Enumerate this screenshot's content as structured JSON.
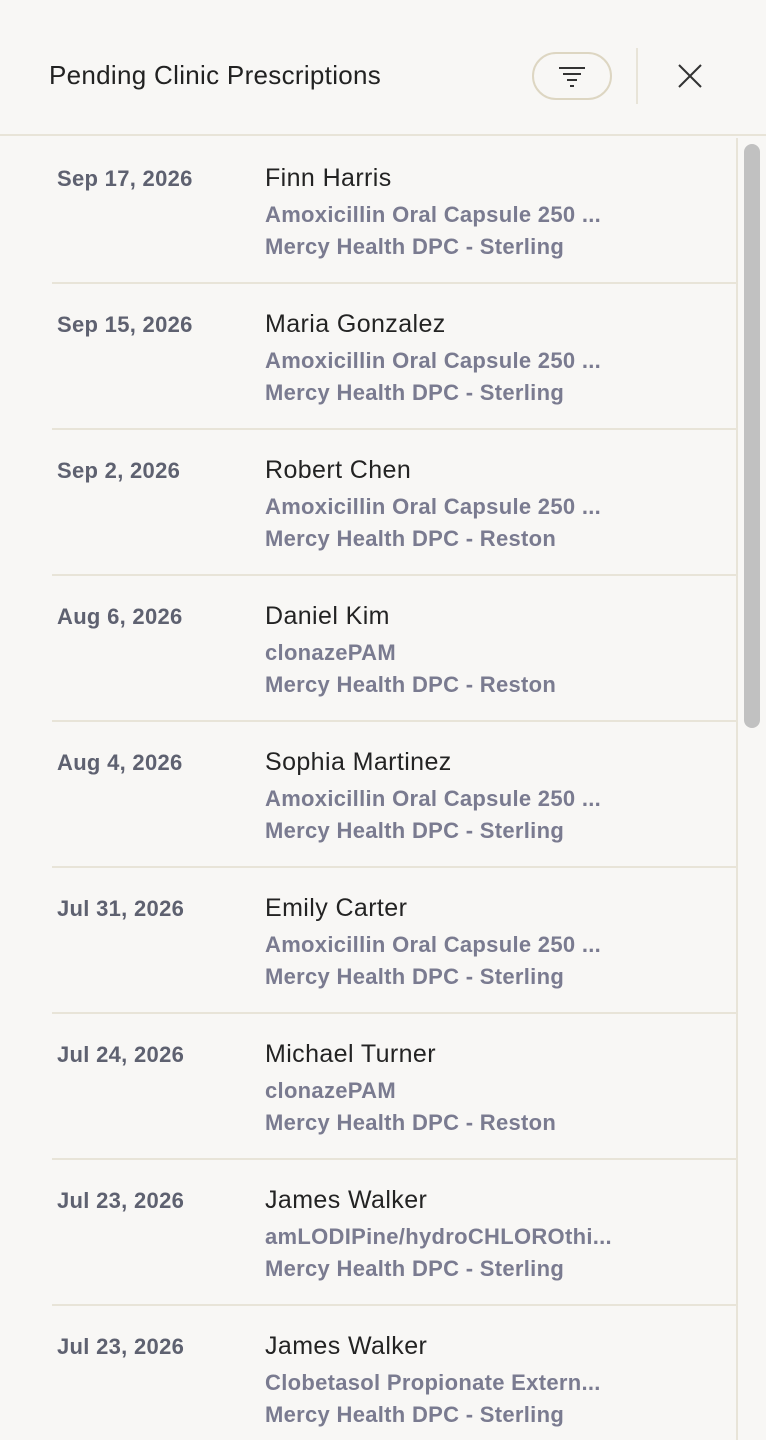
{
  "header": {
    "title": "Pending Clinic Prescriptions",
    "filter_icon": "filter-icon",
    "close_icon": "close-icon"
  },
  "prescriptions": [
    {
      "date": "Sep 17, 2026",
      "patient": "Finn Harris",
      "drug": "Amoxicillin Oral Capsule 250 ...",
      "clinic": "Mercy Health DPC - Sterling"
    },
    {
      "date": "Sep 15, 2026",
      "patient": "Maria Gonzalez",
      "drug": "Amoxicillin Oral Capsule 250 ...",
      "clinic": "Mercy Health DPC - Sterling"
    },
    {
      "date": "Sep 2, 2026",
      "patient": "Robert Chen",
      "drug": "Amoxicillin Oral Capsule 250 ...",
      "clinic": "Mercy Health DPC - Reston"
    },
    {
      "date": "Aug 6, 2026",
      "patient": "Daniel Kim",
      "drug": "clonazePAM",
      "clinic": "Mercy Health DPC - Reston"
    },
    {
      "date": "Aug 4, 2026",
      "patient": "Sophia Martinez",
      "drug": "Amoxicillin Oral Capsule 250 ...",
      "clinic": "Mercy Health DPC - Sterling"
    },
    {
      "date": "Jul 31, 2026",
      "patient": "Emily Carter",
      "drug": "Amoxicillin Oral Capsule 250 ...",
      "clinic": "Mercy Health DPC - Sterling"
    },
    {
      "date": "Jul 24, 2026",
      "patient": "Michael Turner",
      "drug": "clonazePAM",
      "clinic": "Mercy Health DPC - Reston"
    },
    {
      "date": "Jul 23, 2026",
      "patient": "James Walker",
      "drug": "amLODIPine/hydroCHLOROthi...",
      "clinic": "Mercy Health DPC - Sterling"
    },
    {
      "date": "Jul 23, 2026",
      "patient": "James Walker",
      "drug": "Clobetasol Propionate Extern...",
      "clinic": "Mercy Health DPC - Sterling"
    }
  ]
}
